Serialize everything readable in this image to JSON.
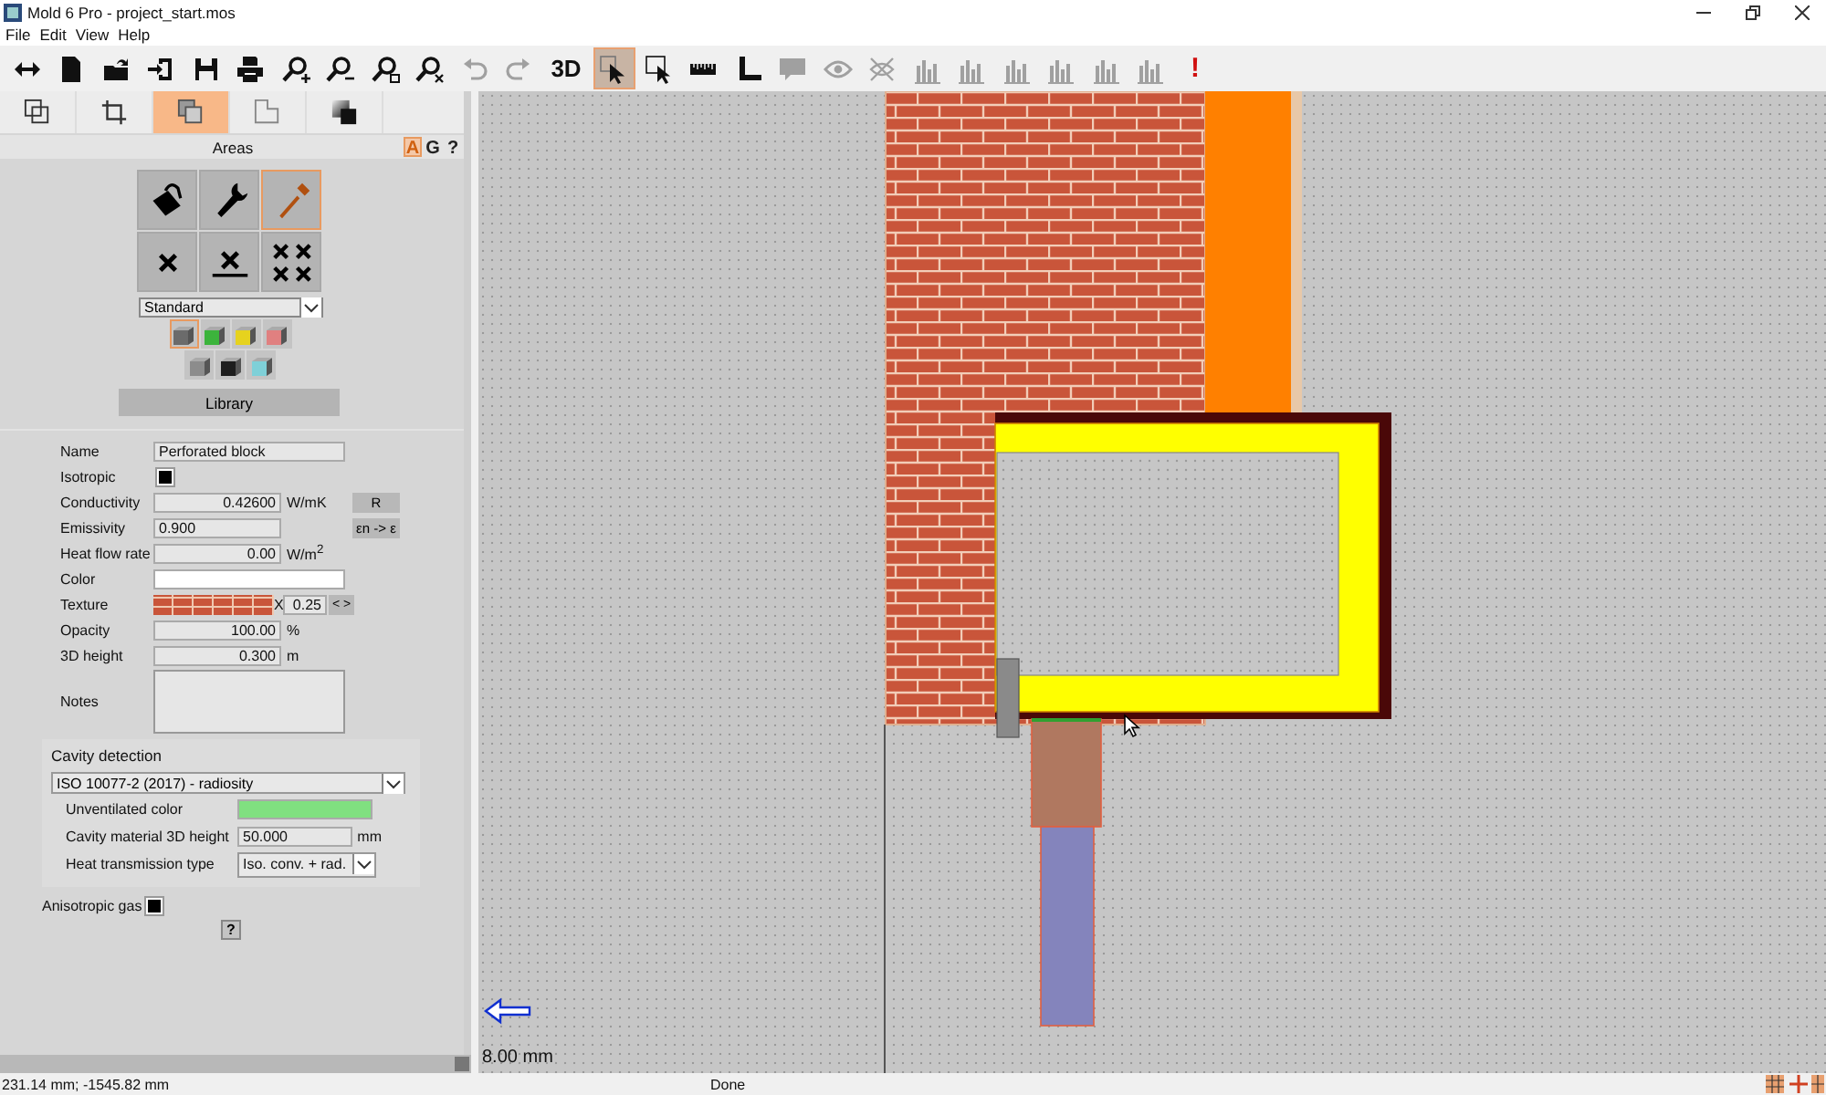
{
  "window": {
    "title": "Mold 6 Pro - project_start.mos"
  },
  "menu": [
    "File",
    "Edit",
    "View",
    "Help"
  ],
  "toolbar": [
    {
      "kind": "swap",
      "selected": false,
      "disabled": false
    },
    {
      "kind": "new",
      "selected": false,
      "disabled": false
    },
    {
      "kind": "open",
      "selected": false,
      "disabled": false
    },
    {
      "kind": "import",
      "selected": false,
      "disabled": false
    },
    {
      "kind": "save",
      "selected": false,
      "disabled": false
    },
    {
      "kind": "print",
      "selected": false,
      "disabled": false
    },
    {
      "kind": "zoomin",
      "selected": false,
      "disabled": false
    },
    {
      "kind": "zoomout",
      "selected": false,
      "disabled": false
    },
    {
      "kind": "zoomwin",
      "selected": false,
      "disabled": false
    },
    {
      "kind": "zoomx",
      "selected": false,
      "disabled": false
    },
    {
      "kind": "undo",
      "selected": false,
      "disabled": true
    },
    {
      "kind": "redo",
      "selected": false,
      "disabled": true
    },
    {
      "kind": "text",
      "label": "3D",
      "selected": false,
      "disabled": false
    },
    {
      "kind": "pointer",
      "selected": true,
      "disabled": false
    },
    {
      "kind": "boxpointer",
      "selected": false,
      "disabled": false
    },
    {
      "kind": "ruler",
      "selected": false,
      "disabled": false
    },
    {
      "kind": "angle",
      "selected": false,
      "disabled": false
    },
    {
      "kind": "bubble",
      "selected": false,
      "disabled": true
    },
    {
      "kind": "eye",
      "selected": false,
      "disabled": true
    },
    {
      "kind": "crossed",
      "selected": false,
      "disabled": true
    },
    {
      "kind": "chart",
      "selected": false,
      "disabled": true
    },
    {
      "kind": "chart",
      "selected": false,
      "disabled": true
    },
    {
      "kind": "chart",
      "selected": false,
      "disabled": true
    },
    {
      "kind": "chart",
      "selected": false,
      "disabled": true
    },
    {
      "kind": "chart",
      "selected": false,
      "disabled": true
    },
    {
      "kind": "chart",
      "selected": false,
      "disabled": true
    },
    {
      "kind": "alert",
      "label": "!",
      "selected": false,
      "disabled": false
    }
  ],
  "panel_tabs": [
    {
      "kind": "overlap",
      "selected": false
    },
    {
      "kind": "crop",
      "selected": false
    },
    {
      "kind": "layers",
      "selected": true
    },
    {
      "kind": "page",
      "selected": false
    },
    {
      "kind": "gradient",
      "selected": false
    }
  ],
  "panel_header": {
    "title": "Areas",
    "modes": [
      {
        "label": "A",
        "selected": true
      },
      {
        "label": "G",
        "selected": false
      },
      {
        "label": "?",
        "selected": false
      }
    ]
  },
  "tools": [
    {
      "kind": "bucket",
      "selected": false
    },
    {
      "kind": "wrench",
      "selected": false
    },
    {
      "kind": "dropper",
      "selected": true
    },
    {
      "kind": "cross",
      "selected": false
    },
    {
      "kind": "ucross",
      "selected": false
    },
    {
      "kind": "crosses",
      "selected": false
    }
  ],
  "preset": "Standard",
  "swatches": [
    [
      {
        "color": "#6b6b6b",
        "selected": true
      },
      {
        "color": "#3cb43c",
        "selected": false
      },
      {
        "color": "#e6d21e",
        "selected": false
      },
      {
        "color": "#e08080",
        "selected": false
      }
    ],
    [
      {
        "color": "#8c8c8c",
        "selected": false
      },
      {
        "color": "#1e1e1e",
        "selected": false
      },
      {
        "color": "#7fd0d8",
        "selected": false
      }
    ]
  ],
  "library_button": "Library",
  "properties": [
    {
      "kind": "text",
      "label": "Name",
      "value": "Perforated block"
    },
    {
      "kind": "checkbox",
      "label": "Isotropic",
      "checked": true
    },
    {
      "kind": "number",
      "label": "Conductivity",
      "value": "0.42600",
      "unit": "W/mK",
      "button": "R"
    },
    {
      "kind": "entry",
      "label": "Emissivity",
      "value": "0.900",
      "button": "εn -> ε"
    },
    {
      "kind": "number",
      "label": "Heat flow rate",
      "value": "0.00",
      "unit": "W/m$^{2}$"
    },
    {
      "kind": "color",
      "label": "Color",
      "color": "#ffffff"
    },
    {
      "kind": "texture",
      "label": "Texture",
      "axis": "X",
      "value": "0.25",
      "button": "< >"
    },
    {
      "kind": "number",
      "label": "Opacity",
      "value": "100.00",
      "unit": "%"
    },
    {
      "kind": "number",
      "label": "3D height",
      "value": "0.300",
      "unit": "m"
    },
    {
      "kind": "notes",
      "label": "Notes"
    }
  ],
  "cavity": {
    "title": "Cavity detection",
    "method": "ISO 10077-2 (2017) - radiosity",
    "rows": [
      {
        "kind": "color",
        "label": "Unventilated color",
        "color": "#80e080"
      },
      {
        "kind": "number",
        "label": "Cavity material 3D height",
        "value": "50.000",
        "unit": "mm"
      },
      {
        "kind": "select",
        "label": "Heat transmission type",
        "value": "Iso. conv. + rad."
      }
    ]
  },
  "anisotropic_gas": {
    "label": "Anisotropic gas",
    "checked": true
  },
  "help_button": "?",
  "canvas": {
    "scale": "8.00 mm"
  },
  "status_bar": {
    "coordinates": "231.14 mm; -1545.82 mm",
    "message": "Done"
  }
}
